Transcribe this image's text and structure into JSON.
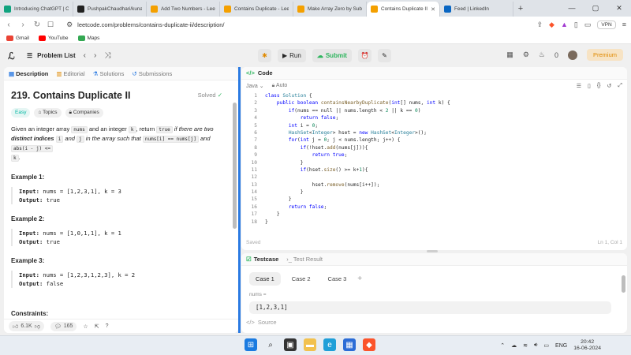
{
  "browser": {
    "tabs": [
      {
        "title": "Introducing ChatGPT | Op",
        "fav": "#10a37f",
        "active": false
      },
      {
        "title": "PushpakChaudhari/kunal",
        "fav": "#222222",
        "active": false
      },
      {
        "title": "Add Two Numbers - Leet",
        "fav": "#f4a000",
        "active": false
      },
      {
        "title": "Contains Duplicate - Leet",
        "fav": "#f4a000",
        "active": false
      },
      {
        "title": "Make Array Zero by Subt",
        "fav": "#f4a000",
        "active": false
      },
      {
        "title": "Contains Duplicate II",
        "fav": "#f4a000",
        "active": true
      },
      {
        "title": "Feed | LinkedIn",
        "fav": "#0a66c2",
        "active": false
      }
    ],
    "url": "leetcode.com/problems/contains-duplicate-ii/description/",
    "vpn_label": "VPN",
    "bookmarks": [
      {
        "label": "Gmail",
        "color": "#ea4335"
      },
      {
        "label": "YouTube",
        "color": "#ff0000"
      },
      {
        "label": "Maps",
        "color": "#34a853"
      }
    ]
  },
  "lc_nav": {
    "problem_list": "Problem List",
    "run": "Run",
    "submit": "Submit",
    "coins": "0",
    "premium": "Premium"
  },
  "left_tabs": {
    "description": "Description",
    "editorial": "Editorial",
    "solutions": "Solutions",
    "submissions": "Submissions"
  },
  "problem": {
    "title": "219. Contains Duplicate II",
    "solved": "Solved",
    "difficulty": "Easy",
    "topics": "Topics",
    "companies": "Companies",
    "stmt_1": "Given an integer array ",
    "stmt_code_nums": "nums",
    "stmt_2": " and an integer ",
    "stmt_code_k": "k",
    "stmt_3": ", return ",
    "stmt_code_true": "true",
    "stmt_4": " if there are two ",
    "stmt_bold": "distinct indices",
    "stmt_code_i": "i",
    "stmt_5": " and ",
    "stmt_code_j": "j",
    "stmt_6": " in the array such that ",
    "stmt_code_eq": "nums[i] == nums[j]",
    "stmt_7": " and ",
    "stmt_code_abs": "abs(i - j) <=",
    "stmt_code_k2": "k",
    "stmt_8": ".",
    "examples": [
      {
        "heading": "Example 1:",
        "input_label": "Input:",
        "input": "nums = [1,2,3,1], k = 3",
        "output_label": "Output:",
        "output": "true"
      },
      {
        "heading": "Example 2:",
        "input_label": "Input:",
        "input": "nums = [1,0,1,1], k = 1",
        "output_label": "Output:",
        "output": "true"
      },
      {
        "heading": "Example 3:",
        "input_label": "Input:",
        "input": "nums = [1,2,3,1,2,3], k = 2",
        "output_label": "Output:",
        "output": "false"
      }
    ],
    "constraints": "Constraints:",
    "likes": "6.1K",
    "comments": "165"
  },
  "editor": {
    "header": "Code",
    "language": "Java",
    "auto": "Auto",
    "saved": "Saved",
    "cursor": "Ln 1, Col 1",
    "lines": [
      "class Solution {",
      "    public boolean containsNearbyDuplicate(int[] nums, int k) {",
      "        if(nums == null || nums.length < 2 || k == 0)",
      "            return false;",
      "        int i = 0;",
      "        HashSet<Integer> hset = new HashSet<Integer>();",
      "        for(int j = 0; j < nums.length; j++) {",
      "            if(!hset.add(nums[j])){",
      "                return true;",
      "            }",
      "            if(hset.size() >= k+1){",
      "",
      "                hset.remove(nums[i++]);",
      "            }",
      "        }",
      "        return false;",
      "    }",
      "}"
    ]
  },
  "testcase": {
    "tab_testcase": "Testcase",
    "tab_result": "Test Result",
    "cases": [
      "Case 1",
      "Case 2",
      "Case 3"
    ],
    "var_label": "nums =",
    "value": "[1,2,3,1]",
    "source": "Source"
  },
  "taskbar": {
    "lang": "ENG",
    "time": "20:42",
    "date": "16-06-2024"
  }
}
